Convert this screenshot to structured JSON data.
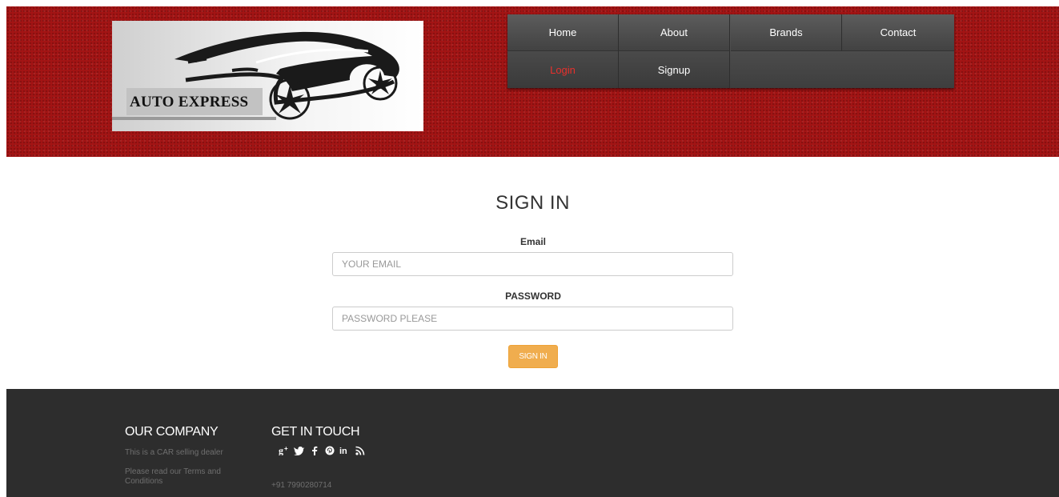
{
  "logo": {
    "text": "AUTO EXPRESS"
  },
  "nav": {
    "items": [
      {
        "label": "Home"
      },
      {
        "label": "About"
      },
      {
        "label": "Brands"
      },
      {
        "label": "Contact"
      },
      {
        "label": "Login"
      },
      {
        "label": "Signup"
      }
    ],
    "active": "Login",
    "active_color": "#e8302c"
  },
  "form": {
    "title": "SIGN IN",
    "email_label": "Email",
    "email_placeholder": "YOUR EMAIL",
    "password_label": "PASSWORD",
    "password_placeholder": "PASSWORD PLEASE",
    "submit_label": "SIGN IN",
    "submit_color": "#f0ad4e"
  },
  "footer": {
    "company": {
      "heading": "OUR COMPANY",
      "line1": "This is a CAR selling dealer",
      "line2": "Please read our Terms and Conditions"
    },
    "contact": {
      "heading": "GET IN TOUCH",
      "phone": "+91 7990280714",
      "social_icons": [
        "google-plus-icon",
        "twitter-icon",
        "facebook-icon",
        "pinterest-icon",
        "linkedin-icon",
        "rss-icon"
      ]
    }
  },
  "colors": {
    "header_red": "#a31414",
    "nav_dark": "#444444",
    "footer_bg": "#2d2d2d"
  }
}
